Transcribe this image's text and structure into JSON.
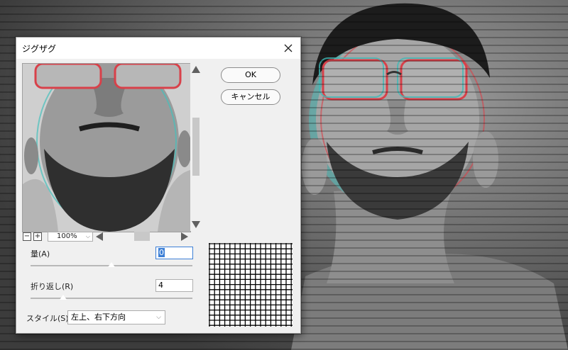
{
  "dialog": {
    "title": "ジグザグ",
    "ok_label": "OK",
    "cancel_label": "キャンセル",
    "zoom": {
      "minus": "−",
      "plus": "+",
      "value": "100%",
      "chevron": "⌵"
    },
    "params": {
      "amount_label": "量(A)",
      "amount_value": "0",
      "amount_slider_fraction": 0.5,
      "ridges_label": "折り返し(R)",
      "ridges_value": "4",
      "ridges_slider_fraction": 0.2,
      "style_label": "スタイル(S)",
      "style_value": "左上、右下方向",
      "style_chevron": "⌵"
    }
  },
  "colors": {
    "dialog_bg": "#f0f0f0",
    "accent": "#3c7fd6"
  },
  "icons": {
    "close": "close-icon",
    "scroll_up": "arrow-up-icon",
    "scroll_down": "arrow-down-icon",
    "scroll_left": "arrow-left-icon",
    "scroll_right": "arrow-right-icon"
  }
}
